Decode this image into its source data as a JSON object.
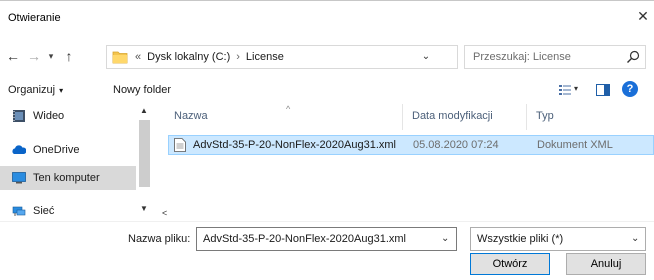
{
  "window": {
    "title": "Otwieranie",
    "close_glyph": "✕"
  },
  "nav": {
    "back_glyph": "←",
    "forward_glyph": "→",
    "recent_glyph": "▾",
    "up_glyph": "↑",
    "address": {
      "overflow": "«",
      "crumbs": [
        "Dysk lokalny (C:)",
        "License"
      ],
      "separator": "›",
      "dropdown_glyph": "⌄"
    },
    "refresh_glyph": "↻",
    "search": {
      "placeholder": "Przeszukaj: License",
      "icon": "search-icon"
    }
  },
  "toolbar": {
    "organize_label": "Organizuj",
    "organize_dd": "▾",
    "new_folder_label": "Nowy folder",
    "view_dd": "▾",
    "help_label": "?"
  },
  "sidebar": {
    "items": [
      {
        "label": "Wideo",
        "icon": "video-folder-icon"
      },
      {
        "label": "OneDrive",
        "icon": "onedrive-icon"
      },
      {
        "label": "Ten komputer",
        "icon": "computer-icon",
        "selected": true
      },
      {
        "label": "Sieć",
        "icon": "network-icon"
      }
    ],
    "scroll_up": "▲",
    "scroll_down": "▼"
  },
  "file_list": {
    "columns": [
      "Nazwa",
      "Data modyfikacji",
      "Typ"
    ],
    "sort_glyph": "^",
    "rows": [
      {
        "name": "AdvStd-35-P-20-NonFlex-2020Aug31.xml",
        "date": "05.08.2020 07:24",
        "type": "Dokument XML",
        "selected": true
      }
    ],
    "hscroll_left": "<"
  },
  "bottom": {
    "filename_label": "Nazwa pliku:",
    "filename_value": "AdvStd-35-P-20-NonFlex-2020Aug31.xml",
    "filename_dd": "⌄",
    "filetype_value": "Wszystkie pliki (*)",
    "filetype_dd": "⌄",
    "open_label": "Otwórz",
    "cancel_label": "Anuluj"
  },
  "colors": {
    "accent": "#0078d7",
    "selection": "#cce8ff",
    "selection_border": "#99d1ff",
    "help": "#1a6fd8",
    "folder": "#f3c44f"
  }
}
